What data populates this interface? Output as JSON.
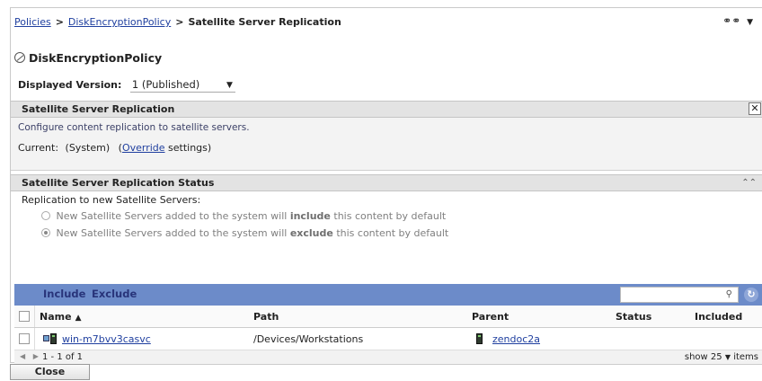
{
  "breadcrumb": {
    "items": [
      "Policies",
      "DiskEncryptionPolicy",
      "Satellite Server Replication"
    ],
    "separator": ">"
  },
  "top_icons": {
    "glasses": "glasses-icon",
    "menu": "dropdown-arrow-icon"
  },
  "policy": {
    "name": "DiskEncryptionPolicy",
    "icon": "policy-icon"
  },
  "version": {
    "label": "Displayed Version:",
    "selected": "1 (Published)"
  },
  "replication_section": {
    "title": "Satellite Server Replication",
    "description": "Configure content replication to satellite servers.",
    "current_prefix": "Current:",
    "current_value": "(System)",
    "override_link": "Override",
    "override_suffix": "settings)"
  },
  "status_section": {
    "title": "Satellite Server Replication Status",
    "replication_label": "Replication to new Satellite Servers:",
    "option_include": {
      "prefix": "New Satellite Servers added to the system will",
      "bold": "include",
      "suffix": "this content by default",
      "checked": false
    },
    "option_exclude": {
      "prefix": "New Satellite Servers added to the system will",
      "bold": "exclude",
      "suffix": "this content by default",
      "checked": true
    }
  },
  "toolbar": {
    "include_label": "Include",
    "exclude_label": "Exclude",
    "search_value": ""
  },
  "table": {
    "columns": [
      "Name",
      "Path",
      "Parent",
      "Status",
      "Included"
    ],
    "rows": [
      {
        "name": "win-m7bvv3casvc",
        "path": "/Devices/Workstations",
        "parent": "zendoc2a",
        "status": "",
        "included": ""
      }
    ]
  },
  "pager": {
    "count": "1 - 1 of 1",
    "show_label": "show",
    "page_size": "25",
    "items_label": "items"
  },
  "footer": {
    "close_label": "Close"
  },
  "colors": {
    "toolbar": "#6c8bc9",
    "link": "#1f3f9f",
    "section_header": "#e3e3e3"
  }
}
